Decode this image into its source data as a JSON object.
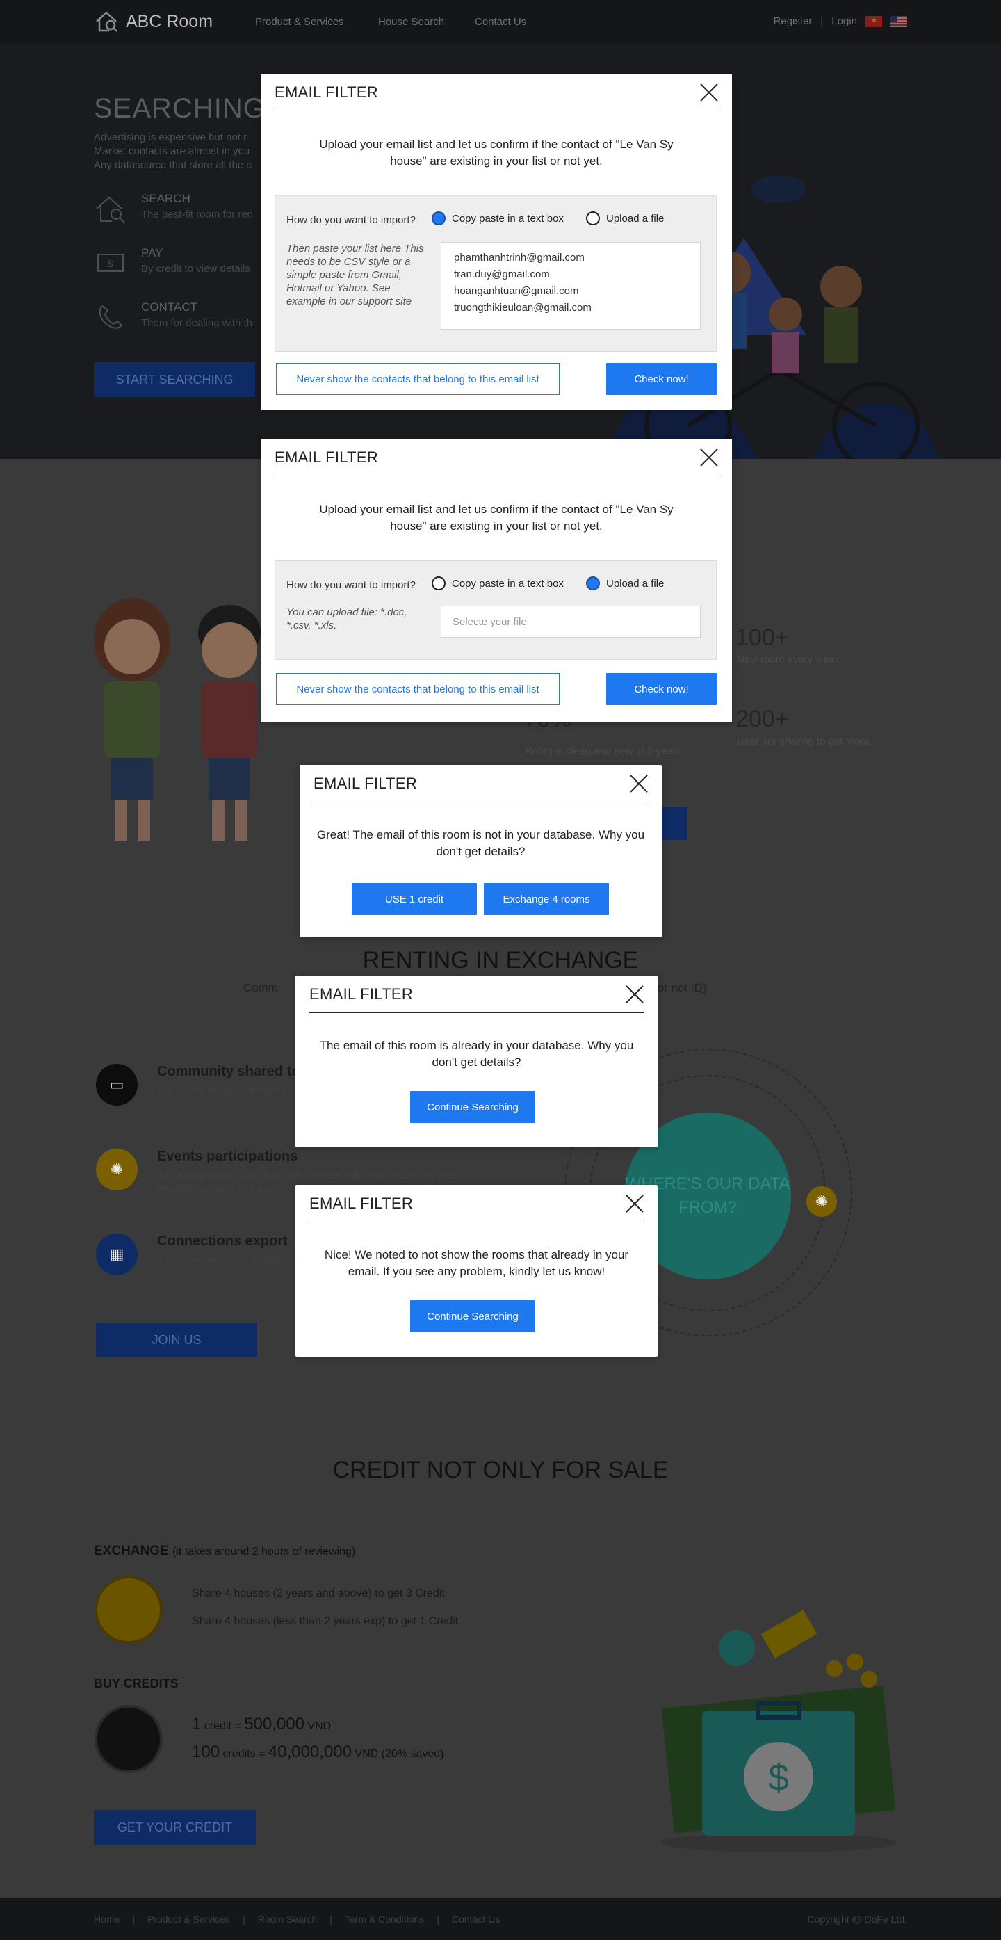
{
  "nav": {
    "logo_text": "ABC Room",
    "links": [
      "Product & Services",
      "House Search",
      "Contact Us"
    ],
    "register": "Register",
    "separator": "|",
    "login": "Login"
  },
  "hero": {
    "title": "SEARCHING O",
    "desc_lines": [
      "Advertising is expensive but not r",
      "Market contacts are almost in you",
      "Any datasource that store all the c"
    ],
    "features": [
      {
        "title": "SEARCH",
        "sub": "The best-fit room for ren"
      },
      {
        "title": "PAY",
        "sub": "By credit to view details"
      },
      {
        "title": "CONTACT",
        "sub": "Them for dealing with th"
      }
    ],
    "button": "START SEARCHING"
  },
  "stats": [
    {
      "value": "100+",
      "label": "New room every week"
    },
    {
      "value": "70%",
      "label": "Room is clean and new in 5 years"
    },
    {
      "value": "200+",
      "label": "User are sharing to get more"
    }
  ],
  "exchange_section": {
    "title": "RENTING IN EXCHANGE",
    "subtitle_left": "Comm",
    "subtitle_right": "o rent or not :D)",
    "items": [
      {
        "title": "Community shared to e",
        "text": "It is a long established fact t the readable content of a pa"
      },
      {
        "title": "Events participations",
        "text": "It is a long established fact that a reader will be distracted by the readable content of a pa"
      },
      {
        "title": "Connections export",
        "text": "It is a long established fact t the readable content of a pa"
      }
    ],
    "circle_text": "WHERE'S OUR DATA FROM?",
    "join_button": "JOIN US"
  },
  "credit_section": {
    "title": "CREDIT NOT ONLY FOR SALE",
    "exchange_label": "EXCHANGE",
    "exchange_note": "(it takes around 2 hours of reviewing)",
    "exchange_lines": [
      "Share 4 houses (2 years and above) to get 3 Credit",
      "Share 4 houses (less than 2 years exp) to get 1 Credit"
    ],
    "buy_label": "BUY CREDITS",
    "price1": {
      "qty": "1",
      "unit": "credit =",
      "amount": "500,000",
      "currency": "VND",
      "note": ""
    },
    "price2": {
      "qty": "100",
      "unit": "credits =",
      "amount": "40,000,000",
      "currency": "VND",
      "note": "(20% saved)"
    },
    "button": "GET YOUR CREDIT"
  },
  "footer": {
    "links": [
      "Home",
      "|",
      "Product & Services",
      "|",
      "Room Search",
      "|",
      "Term & Conditions",
      "|",
      "Contact Us"
    ],
    "copyright": "Copyright @ DoFe Ltd."
  },
  "modal1": {
    "title": "EMAIL FILTER",
    "message": "Upload your email list and let us confirm if the contact of \"Le Van Sy house\" are existing in your list or not yet.",
    "question": "How do you want to import?",
    "option_paste": "Copy paste in a text box",
    "option_upload": "Upload a file",
    "selected": "paste",
    "hint": "Then paste your list here This needs to be CSV style or a simple paste from Gmail, Hotmail or Yahoo. See example in our support site",
    "emails": [
      "phamthanhtrinh@gmail.com",
      "tran.duy@gmail.com",
      "hoanganhtuan@gmail.com",
      "truongthikieuloan@gmail.com"
    ],
    "secondary_button": "Never show the contacts that belong to this email list",
    "primary_button": "Check now!"
  },
  "modal2": {
    "title": "EMAIL FILTER",
    "message": "Upload your email list and let us confirm if the contact of \"Le Van Sy house\" are existing in your list or not yet.",
    "question": "How do you want to import?",
    "option_paste": "Copy paste in a text box",
    "option_upload": "Upload a file",
    "selected": "upload",
    "hint": "You can upload file: *.doc, *.csv, *.xls.",
    "file_placeholder": "Selecte your file",
    "secondary_button": "Never show the contacts that belong to this email list",
    "primary_button": "Check now!"
  },
  "modal3": {
    "title": "EMAIL FILTER",
    "message": "Great! The email of this room is not in your database. Why you don't get details?",
    "button_credit": "USE 1 credit",
    "button_exchange": "Exchange 4 rooms"
  },
  "modal4": {
    "title": "EMAIL FILTER",
    "message": "The email of this room is already in your database. Why you don't get details?",
    "button": "Continue Searching"
  },
  "modal5": {
    "title": "EMAIL FILTER",
    "message": "Nice! We noted to not show the rooms that already in your email. If you see any problem, kindly let us know!",
    "button": "Continue Searching"
  },
  "colors": {
    "primary": "#1e78f0",
    "overlay_dark": "#1a1b1e",
    "teal": "#1a6b64"
  }
}
